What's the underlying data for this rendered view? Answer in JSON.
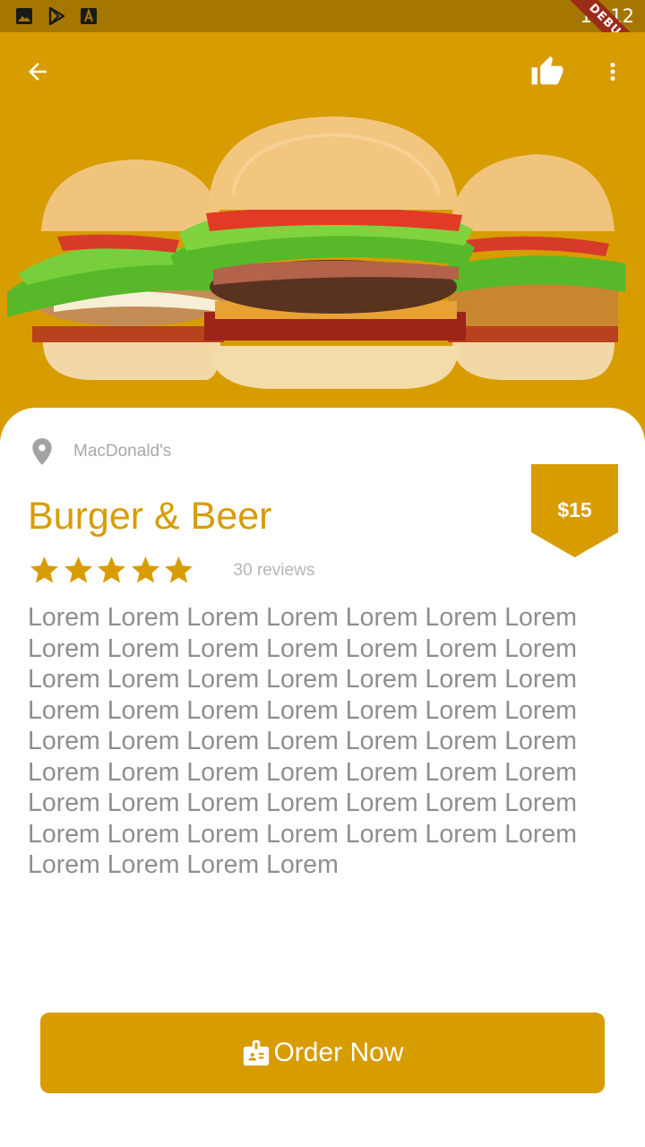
{
  "status_bar": {
    "time": "12:12",
    "debug_label": "DEBUG",
    "icons": [
      "image-icon",
      "play-store-icon",
      "font-icon"
    ]
  },
  "app_bar": {
    "back_icon": "arrow-back-icon",
    "like_icon": "thumb-up-icon",
    "menu_icon": "more-vert-icon"
  },
  "hero": {
    "image": "burgers-photo"
  },
  "product": {
    "restaurant": "MacDonald's",
    "title": "Burger & Beer",
    "price": "$15",
    "rating_stars": 5,
    "reviews": "30 reviews",
    "description": "Lorem Lorem Lorem Lorem Lorem Lorem Lorem Lorem Lorem Lorem Lorem Lorem Lorem Lorem Lorem Lorem Lorem Lorem Lorem Lorem Lorem Lorem Lorem Lorem Lorem Lorem Lorem Lorem Lorem Lorem Lorem Lorem Lorem Lorem Lorem Lorem Lorem Lorem Lorem Lorem Lorem Lorem Lorem Lorem Lorem Lorem Lorem Lorem Lorem Lorem Lorem Lorem Lorem Lorem Lorem Lorem Lorem Lorem Lorem Lorem"
  },
  "order_button": {
    "label": "Order Now",
    "icon": "badge-icon"
  },
  "colors": {
    "accent": "#d79c00",
    "status_bar": "#a57700",
    "text_muted": "#8e8e8e"
  }
}
